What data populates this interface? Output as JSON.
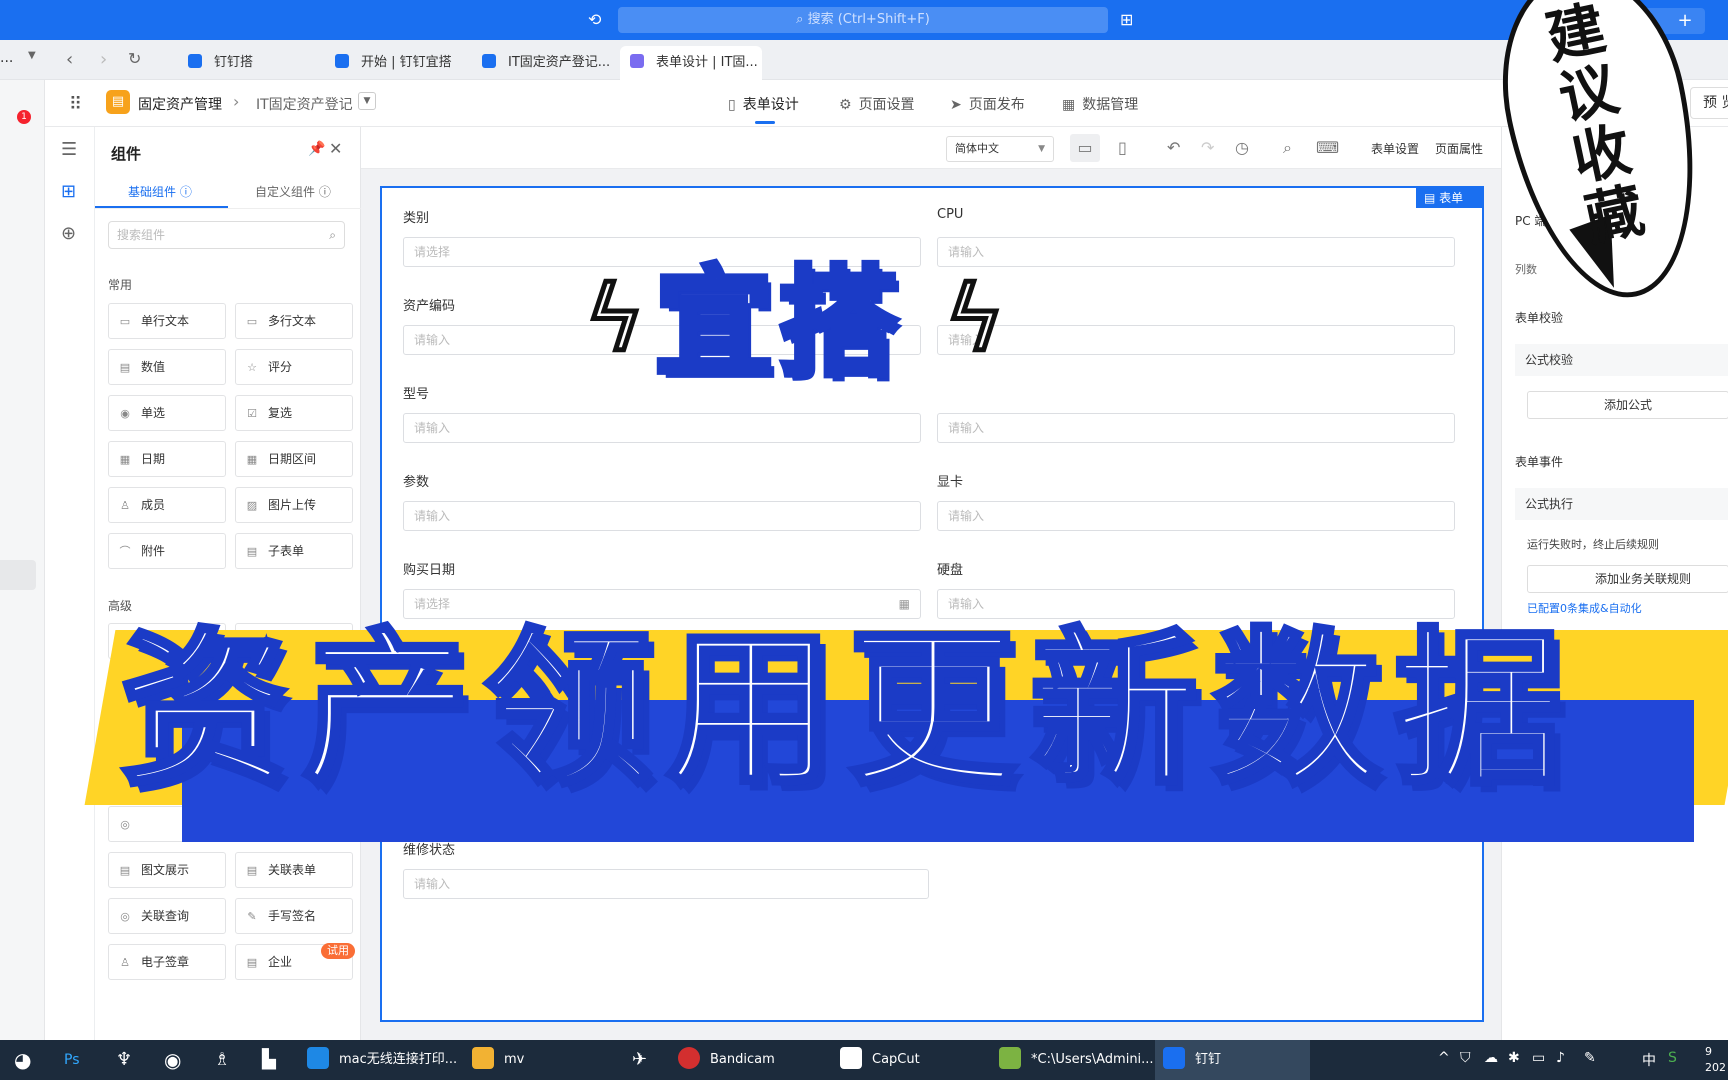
{
  "titlebar": {
    "search_placeholder": "搜索 (Ctrl+Shift+F)",
    "history_icon": "history-icon",
    "apps_icon": "apps-icon",
    "plus": "+"
  },
  "tabs": [
    {
      "label": "钉钉搭",
      "active": false
    },
    {
      "label": "开始 | 钉钉宜搭",
      "active": false
    },
    {
      "label": "IT固定资产登记...",
      "active": false
    },
    {
      "label": "表单设计 | IT固...",
      "active": true
    }
  ],
  "left_strip": {
    "dots": "...",
    "badge": "1"
  },
  "app_header": {
    "app_name": "固定资产管理",
    "form_name": "IT固定资产登记",
    "nav": [
      {
        "label": "表单设计",
        "icon": "▯",
        "active": true
      },
      {
        "label": "页面设置",
        "icon": "⚙",
        "active": false
      },
      {
        "label": "页面发布",
        "icon": "➤",
        "active": false
      },
      {
        "label": "数据管理",
        "icon": "▦",
        "active": false
      }
    ],
    "preview": "预 览"
  },
  "component_panel": {
    "title": "组件",
    "tab_basic": "基础组件 ⓘ",
    "tab_custom": "自定义组件 ⓘ",
    "search_placeholder": "搜索组件",
    "group_common": "常用",
    "group_advanced": "高级",
    "common": [
      {
        "label": "单行文本",
        "icon": "▭"
      },
      {
        "label": "多行文本",
        "icon": "▭"
      },
      {
        "label": "数值",
        "icon": "▤"
      },
      {
        "label": "评分",
        "icon": "☆"
      },
      {
        "label": "单选",
        "icon": "◉"
      },
      {
        "label": "复选",
        "icon": "☑"
      },
      {
        "label": "日期",
        "icon": "▦"
      },
      {
        "label": "日期区间",
        "icon": "▦"
      },
      {
        "label": "成员",
        "icon": "♙"
      },
      {
        "label": "图片上传",
        "icon": "▨"
      },
      {
        "label": "附件",
        "icon": "⌒"
      },
      {
        "label": "子表单",
        "icon": "▤"
      }
    ],
    "advanced": [
      {
        "label": "图文展示",
        "icon": "▤"
      },
      {
        "label": "关联表单",
        "icon": "▤"
      },
      {
        "label": "关联查询",
        "icon": "◎"
      },
      {
        "label": "手写签名",
        "icon": "✎"
      },
      {
        "label": "电子签章",
        "icon": "♙"
      },
      {
        "label": "企业",
        "icon": "▤"
      }
    ],
    "trial_badge": "试用"
  },
  "canvas_toolbar": {
    "language": "简体中文",
    "form_settings": "表单设置",
    "page_props": "页面属性"
  },
  "form": {
    "badge": "表单",
    "fields": [
      {
        "label": "类别",
        "placeholder": "请选择"
      },
      {
        "label": "CPU",
        "placeholder": "请输入"
      },
      {
        "label": "资产编码",
        "placeholder": "请输入"
      },
      {
        "label": "",
        "placeholder": "请输入"
      },
      {
        "label": "型号",
        "placeholder": "请输入"
      },
      {
        "label": "",
        "placeholder": "请输入"
      },
      {
        "label": "参数",
        "placeholder": "请输入"
      },
      {
        "label": "显卡",
        "placeholder": "请输入"
      },
      {
        "label": "购买日期",
        "placeholder": "请选择"
      },
      {
        "label": "硬盘",
        "placeholder": "请输入"
      },
      {
        "label": "维修状态",
        "placeholder": "请输入"
      }
    ]
  },
  "right_panel": {
    "pc_settings": "PC 端设置",
    "columns": "列数",
    "validation": "表单校验",
    "formula_check": "公式校验",
    "add_formula": "添加公式",
    "events": "表单事件",
    "formula_exec": "公式执行",
    "fail_note": "运行失败时，终止后续规则",
    "add_rule": "添加业务关联规则",
    "configured": "已配置0条集成&自动化"
  },
  "overlay": {
    "yida": "宜搭",
    "headline": "资产领用更新数据",
    "bubble": "建议收藏"
  },
  "taskbar": {
    "items": [
      {
        "label": "mac无线连接打印...",
        "color": "#1e88e5"
      },
      {
        "label": "mv",
        "color": "#f2b233"
      },
      {
        "label": "Bandicam",
        "color": "#d32f2f"
      },
      {
        "label": "CapCut",
        "color": "#222222"
      },
      {
        "label": "*C:\\Users\\Admini...",
        "color": "#7cb342"
      },
      {
        "label": "钉钉",
        "color": "#1a6ff0"
      }
    ],
    "ime": "中",
    "clock_top": "9",
    "clock_bottom": "202"
  }
}
